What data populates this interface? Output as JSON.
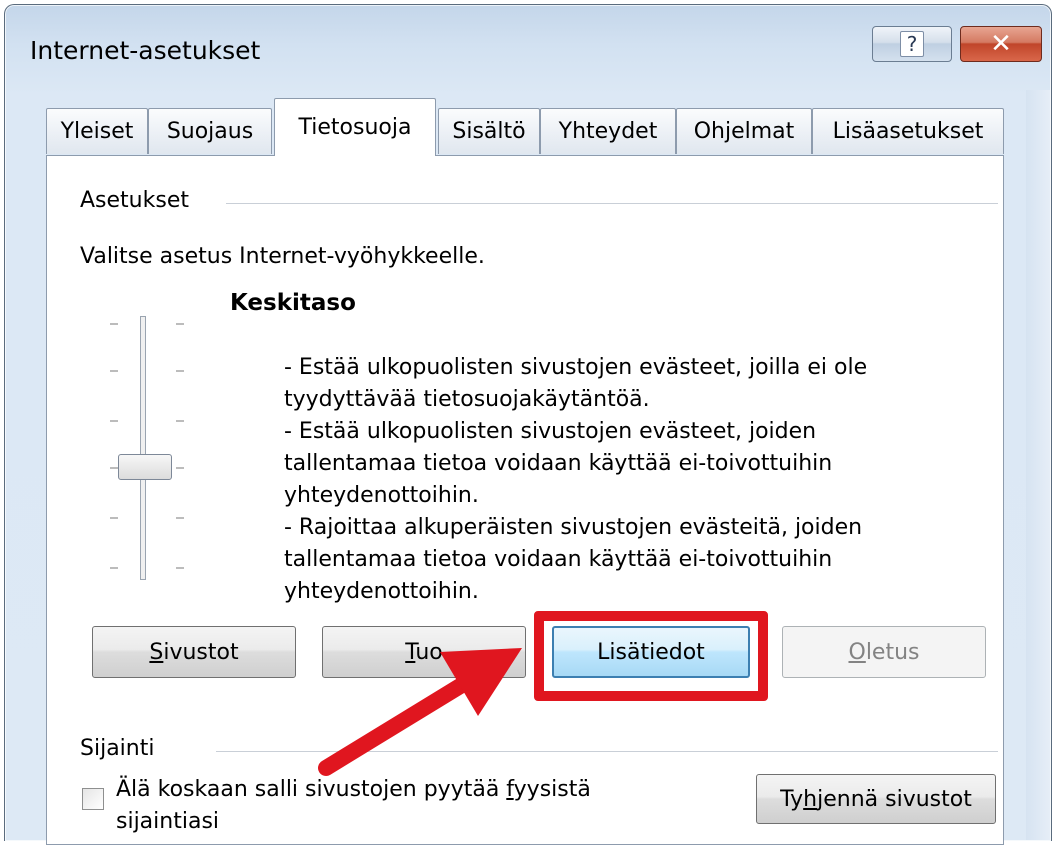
{
  "window": {
    "title": "Internet-asetukset",
    "help_label": "?",
    "close_label": "✕"
  },
  "tabs": [
    {
      "label": "Yleiset"
    },
    {
      "label": "Suojaus"
    },
    {
      "label": "Tietosuoja",
      "active": true
    },
    {
      "label": "Sisältö"
    },
    {
      "label": "Yhteydet"
    },
    {
      "label": "Ohjelmat"
    },
    {
      "label": "Lisäasetukset"
    }
  ],
  "settings": {
    "group_label": "Asetukset",
    "instruction": "Valitse asetus Internet-vyöhykkeelle.",
    "level_title": "Keskitaso",
    "level_description": "- Estää ulkopuolisten sivustojen evästeet, joilla ei ole\ntyydyttävää tietosuojakäytäntöä.\n- Estää ulkopuolisten sivustojen evästeet, joiden\ntallentamaa tietoa voidaan käyttää ei-toivottuihin\nyhteydenottoihin.\n- Rajoittaa alkuperäisten sivustojen evästeitä, joiden\ntallentamaa tietoa voidaan käyttää ei-toivottuihin\nyhteydenottoihin.",
    "slider_level": 3,
    "slider_levels": 6
  },
  "buttons": {
    "sites": {
      "label": "Sivustot",
      "accel": "S",
      "rest": "ivustot"
    },
    "import": {
      "label": "Tuo",
      "accel": "T",
      "rest": "uo"
    },
    "advanced": {
      "label": "Lisätiedot"
    },
    "default": {
      "label": "Oletus",
      "accel": "O",
      "rest": "letus"
    }
  },
  "location": {
    "group_label": "Sijainti",
    "checkbox_line1_pre": "Älä koskaan salli sivustojen pyytää ",
    "checkbox_accel": "f",
    "checkbox_line1_post": "yysistä",
    "checkbox_line2": "sijaintiasi",
    "checked": false,
    "clear_pre": "Ty",
    "clear_accel": "h",
    "clear_post": "jennä sivustot"
  },
  "annotation": {
    "highlight_color": "#e0161f"
  }
}
